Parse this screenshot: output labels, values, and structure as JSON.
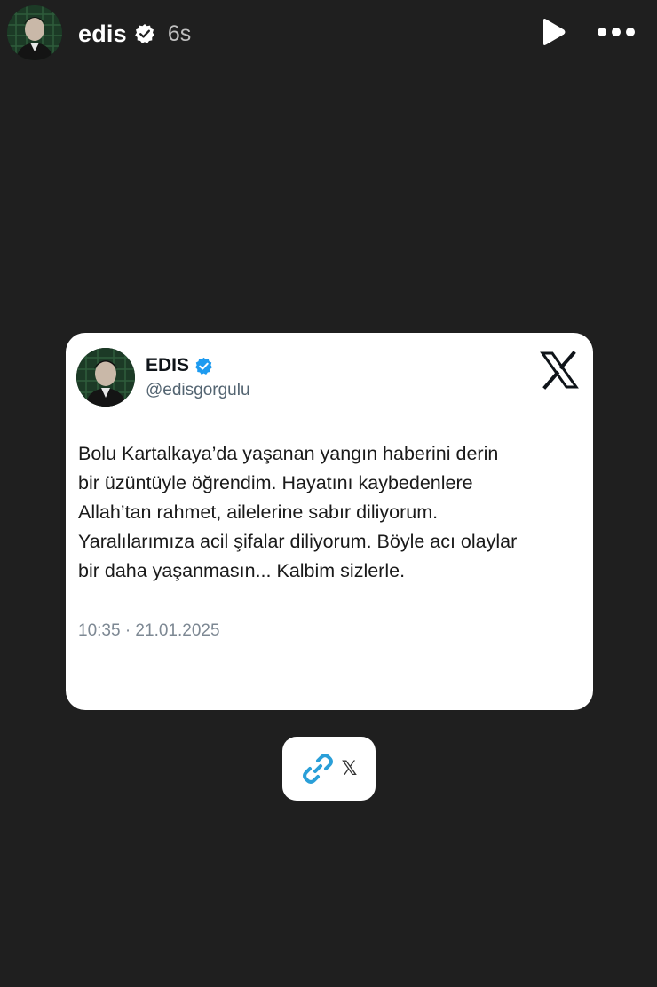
{
  "story": {
    "username": "edis",
    "time_ago": "6s"
  },
  "icons": {
    "verified": "verified-badge-icon",
    "play": "play-icon",
    "more": "more-options-icon",
    "x_logo": "x-logo-icon",
    "link": "link-icon"
  },
  "tweet": {
    "display_name": "EDIS",
    "handle": "@edisgorgulu",
    "lines": [
      "Bolu Kartalkaya’da yaşanan yangın haberini derin",
      "bir üzüntüyle öğrendim. Hayatını kaybedenlere",
      "Allah’tan rahmet, ailelerine sabır diliyorum.",
      "Yaralılarımıza acil şifalar diliyorum. Böyle acı olaylar",
      "bir daha yaşanmasın... Kalbim sizlerle."
    ],
    "timestamp": "10:35 · 21.01.2025"
  },
  "link_sticker": {
    "label": "𝕏"
  },
  "colors": {
    "background": "#1f1f1f",
    "card": "#ffffff",
    "verified_blue": "#1d9bf0",
    "link_blue": "#2a9fd8",
    "muted_text": "#536471"
  }
}
